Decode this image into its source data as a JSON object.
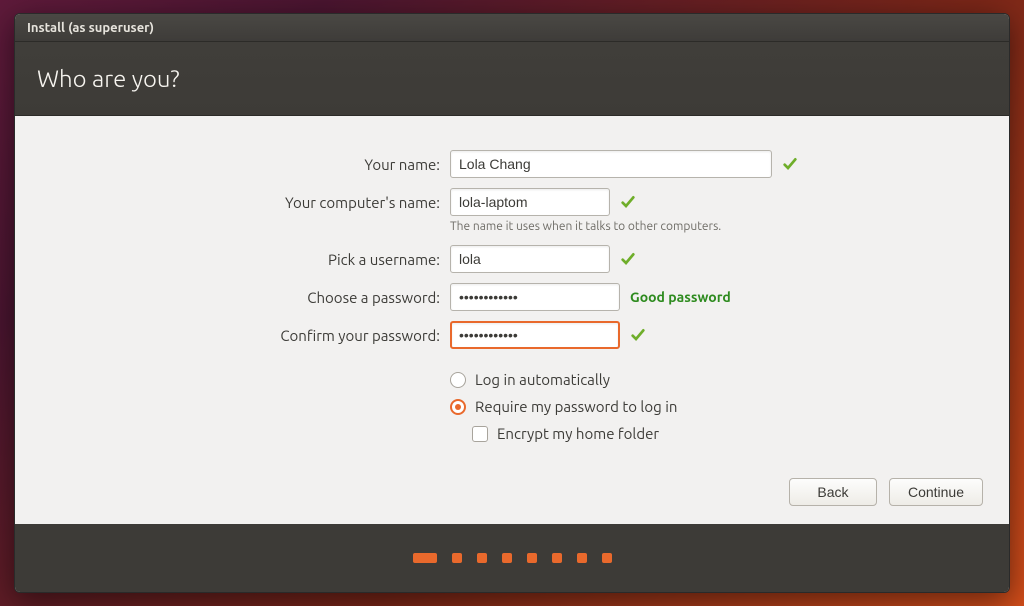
{
  "window": {
    "title": "Install (as superuser)"
  },
  "header": {
    "title": "Who are you?"
  },
  "labels": {
    "name": "Your name:",
    "computer": "Your computer's name:",
    "computer_hint": "The name it uses when it talks to other computers.",
    "username": "Pick a username:",
    "password": "Choose a password:",
    "confirm": "Confirm your password:"
  },
  "fields": {
    "name": "Lola Chang",
    "computer": "lola-laptom",
    "username": "lola",
    "password": "••••••••••••",
    "confirm": "••••••••••••"
  },
  "password_strength": "Good password",
  "options": {
    "auto_login": "Log in automatically",
    "require_password": "Require my password to log in",
    "encrypt_home": "Encrypt my home folder",
    "selected": "require_password"
  },
  "buttons": {
    "back": "Back",
    "continue": "Continue"
  },
  "progress": {
    "total": 8,
    "active_index": 0
  }
}
